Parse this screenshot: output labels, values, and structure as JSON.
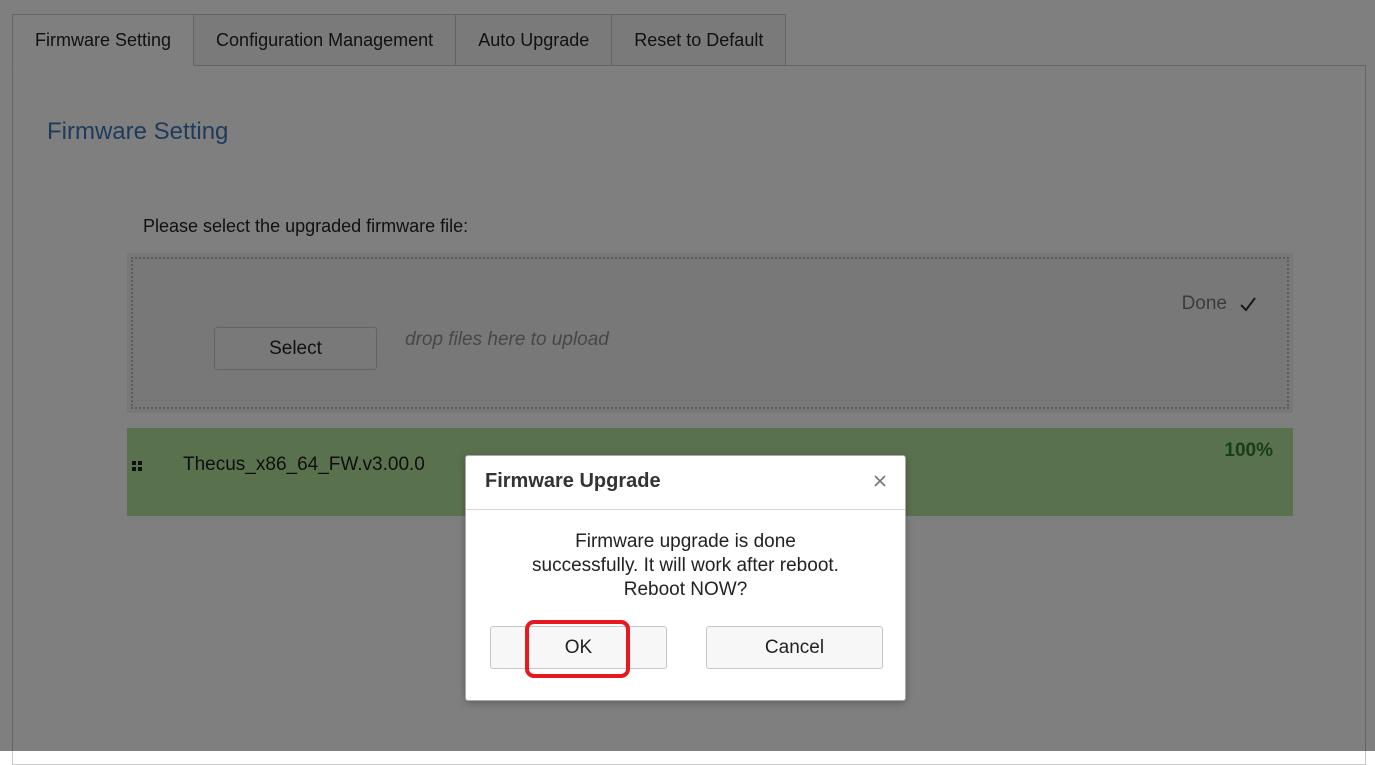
{
  "tabs": [
    {
      "label": "Firmware Setting",
      "active": true
    },
    {
      "label": "Configuration Management",
      "active": false
    },
    {
      "label": "Auto Upgrade",
      "active": false
    },
    {
      "label": "Reset to Default",
      "active": false
    }
  ],
  "page": {
    "title": "Firmware Setting",
    "instruction": "Please select the upgraded firmware file:"
  },
  "upload": {
    "select_label": "Select",
    "drop_hint": "drop files here to upload",
    "status_label": "Done",
    "status_icon": "check-icon"
  },
  "file": {
    "name": "Thecus_x86_64_FW.v3.00.0",
    "progress": "100%",
    "icon": "grid-handle-icon",
    "row_color": "#b4e39c"
  },
  "dialog": {
    "title": "Firmware Upgrade",
    "close_icon": "close-icon",
    "message_lines": [
      "Firmware upgrade is done",
      "successfully. It will work after reboot.",
      "Reboot NOW?"
    ],
    "ok_label": "OK",
    "cancel_label": "Cancel",
    "highlight_color": "#e5191f"
  },
  "colors": {
    "title_blue": "#3b78b8",
    "percent_green": "#2e7d2e"
  }
}
